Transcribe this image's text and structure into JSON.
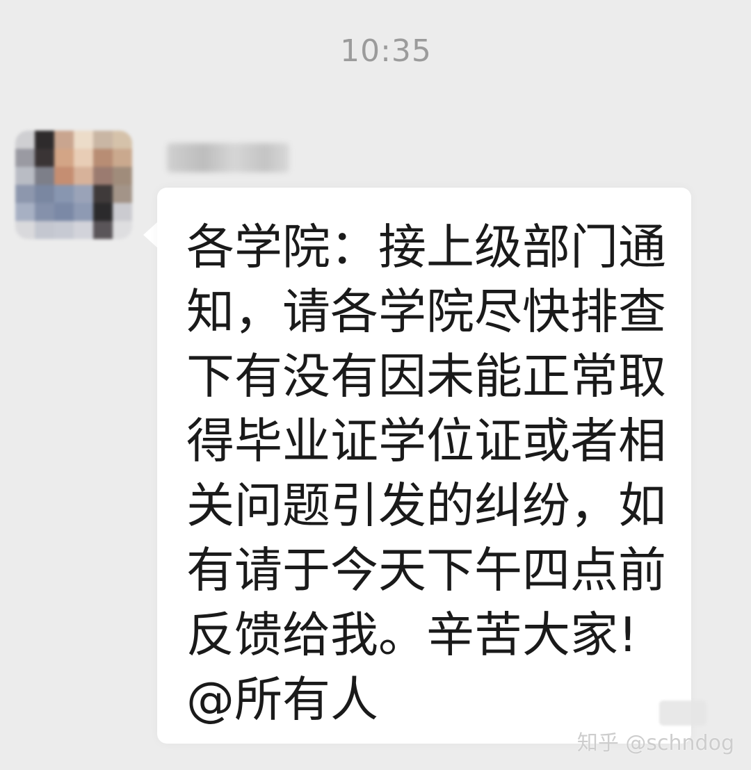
{
  "chat": {
    "timestamp": "10:35",
    "sender": {
      "avatar_palette": [
        "#cfcfd2",
        "#2e2b2c",
        "#c9a58f",
        "#ecdcc9",
        "#c9b6a4",
        "#d5c2aa",
        "#9a9aa2",
        "#3a3435",
        "#d3a586",
        "#e8cdb6",
        "#b88d74",
        "#caa98e",
        "#b9bcc4",
        "#7d7f89",
        "#c58e72",
        "#d7b29a",
        "#9b7b70",
        "#a08c7b",
        "#8d97ad",
        "#7a87a1",
        "#8896b0",
        "#9aa3b8",
        "#3f3a3a",
        "#a39488",
        "#a7b0c3",
        "#8591ab",
        "#7b89a6",
        "#8e9ab3",
        "#2b2a2c",
        "#cbcbd0",
        "#d9d9dc",
        "#c4c7d0",
        "#c7cad3",
        "#d2d3da",
        "#5a5559",
        "#dedee0"
      ]
    },
    "message": {
      "lines": [
        "各学院：接上级部门通",
        "知，请各学院尽快排查",
        "下有没有因未能正常取",
        "得毕业证学位证或者相",
        "关问题引发的纠纷，如",
        "有请于今天下午四点前",
        "反馈给我。辛苦大家!",
        "@所有人"
      ]
    },
    "watermark": "知乎 @schndog"
  }
}
